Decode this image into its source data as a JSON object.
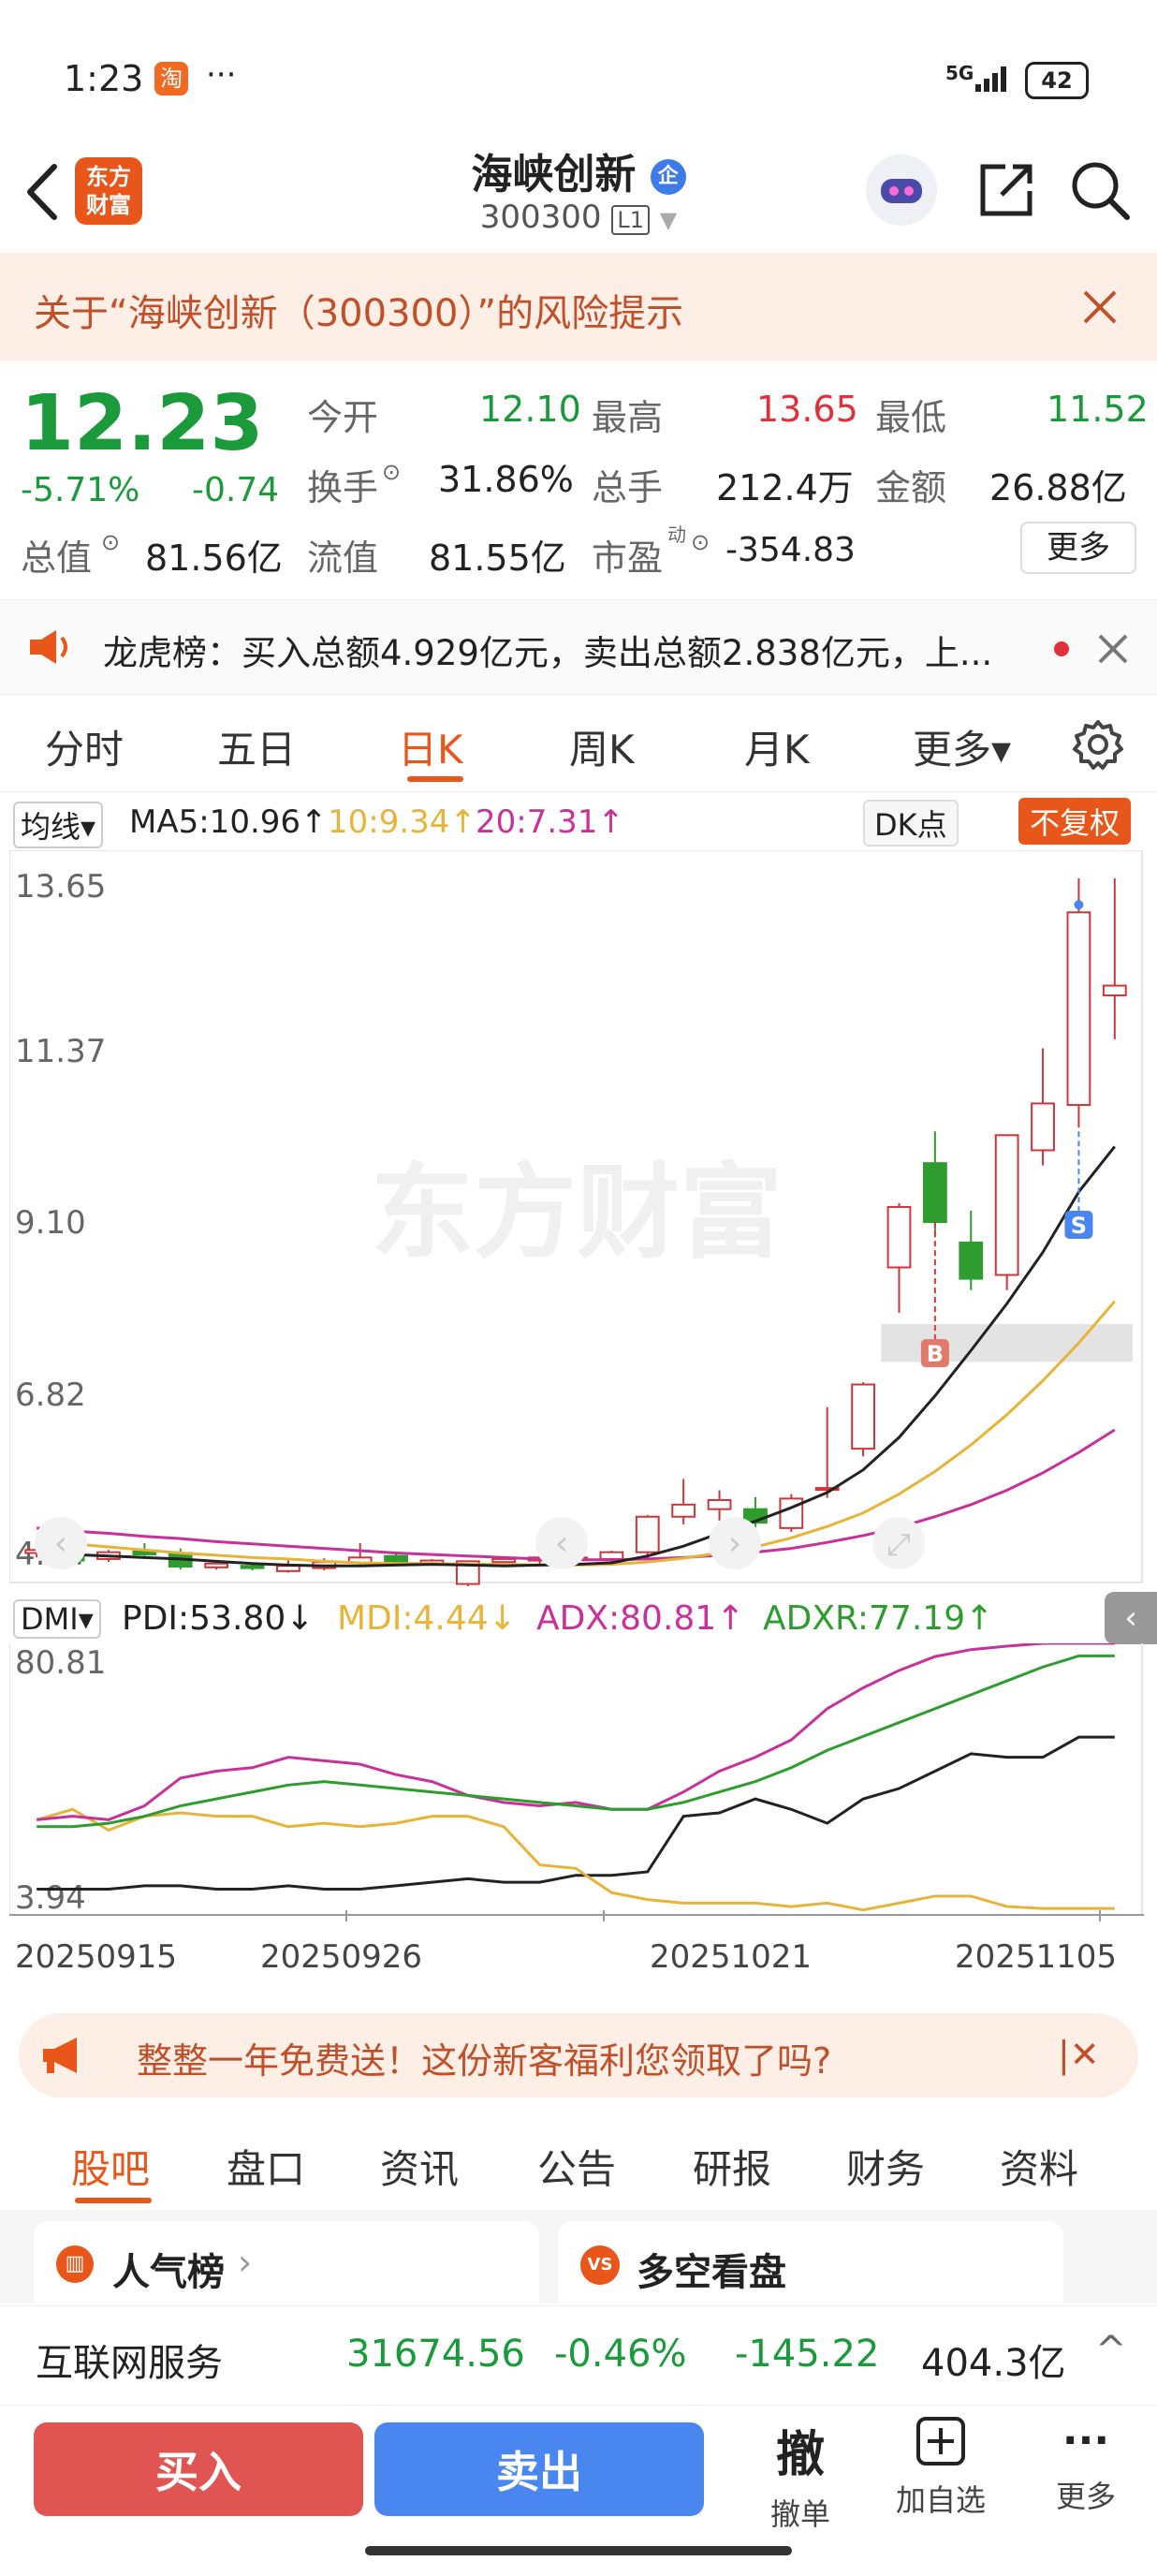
{
  "status_bar": {
    "time": "1:23",
    "app_badge": "淘",
    "dots": "···",
    "network": "5G",
    "battery": "42"
  },
  "header": {
    "logo_line1": "东方",
    "logo_line2": "财富",
    "title": "海峡创新",
    "badge": "企",
    "code": "300300",
    "level": "L1"
  },
  "risk_banner": {
    "text": "关于“海峡创新（300300）”的风险提示"
  },
  "quote": {
    "price": "12.23",
    "change_pct": "-5.71%",
    "change": "-0.74",
    "open_label": "今开",
    "open": "12.10",
    "high_label": "最高",
    "high": "13.65",
    "low_label": "最低",
    "low": "11.52",
    "turnover_label": "换手",
    "turnover": "31.86%",
    "volume_label": "总手",
    "volume": "212.4万",
    "amount_label": "金额",
    "amount": "26.88亿",
    "mcap_label": "总值",
    "mcap": "81.56亿",
    "float_label": "流值",
    "float": "81.55亿",
    "pe_label": "市盈",
    "pe_sup": "动",
    "pe": "-354.83",
    "more_label": "更多"
  },
  "dragon": {
    "text": "龙虎榜：买入总额4.929亿元，卖出总额2.838亿元，上..."
  },
  "ktabs": {
    "items": [
      "分时",
      "五日",
      "日K",
      "周K",
      "月K",
      "更多▾"
    ],
    "active": 2
  },
  "ma_legend": {
    "selector": "均线",
    "ma5": "MA5:10.96↑",
    "ma10": "10:9.34↑",
    "ma20": "20:7.31↑",
    "dk": "DK点",
    "fq": "不复权"
  },
  "colors": {
    "up": "#d0353a",
    "down": "#2e9c2e",
    "ma5": "#222222",
    "ma10": "#e8b437",
    "ma20": "#c8309a",
    "accent": "#e8561a"
  },
  "chart_data": [
    {
      "type": "candlestick",
      "y_ticks": [
        "13.65",
        "11.37",
        "9.10",
        "6.82",
        "4.54"
      ],
      "ylim": [
        4.54,
        13.65
      ],
      "markers": [
        "B",
        "S"
      ],
      "watermark": "东方财富",
      "candles": [
        {
          "o": 4.72,
          "c": 4.76,
          "h": 4.8,
          "l": 4.66
        },
        {
          "o": 4.74,
          "c": 4.62,
          "h": 4.78,
          "l": 4.55
        },
        {
          "o": 4.64,
          "c": 4.73,
          "h": 4.76,
          "l": 4.6
        },
        {
          "o": 4.74,
          "c": 4.7,
          "h": 4.85,
          "l": 4.68
        },
        {
          "o": 4.72,
          "c": 4.54,
          "h": 4.78,
          "l": 4.5
        },
        {
          "o": 4.53,
          "c": 4.58,
          "h": 4.62,
          "l": 4.5
        },
        {
          "o": 4.55,
          "c": 4.52,
          "h": 4.58,
          "l": 4.49
        },
        {
          "o": 4.48,
          "c": 4.55,
          "h": 4.64,
          "l": 4.46
        },
        {
          "o": 4.52,
          "c": 4.6,
          "h": 4.65,
          "l": 4.49
        },
        {
          "o": 4.59,
          "c": 4.66,
          "h": 4.85,
          "l": 4.55
        },
        {
          "o": 4.68,
          "c": 4.58,
          "h": 4.72,
          "l": 4.55
        },
        {
          "o": 4.58,
          "c": 4.62,
          "h": 4.64,
          "l": 4.56
        },
        {
          "o": 4.31,
          "c": 4.61,
          "h": 4.62,
          "l": 4.28
        },
        {
          "o": 4.6,
          "c": 4.64,
          "h": 4.66,
          "l": 4.55
        },
        {
          "o": 4.62,
          "c": 4.66,
          "h": 4.7,
          "l": 4.58
        },
        {
          "o": 4.63,
          "c": 4.66,
          "h": 4.7,
          "l": 4.6
        },
        {
          "o": 4.64,
          "c": 4.73,
          "h": 4.75,
          "l": 4.6
        },
        {
          "o": 4.73,
          "c": 5.2,
          "h": 5.22,
          "l": 4.65
        },
        {
          "o": 5.2,
          "c": 5.36,
          "h": 5.7,
          "l": 5.1
        },
        {
          "o": 5.3,
          "c": 5.42,
          "h": 5.55,
          "l": 5.15
        },
        {
          "o": 5.3,
          "c": 5.12,
          "h": 5.46,
          "l": 5.05
        },
        {
          "o": 5.05,
          "c": 5.44,
          "h": 5.5,
          "l": 5.0
        },
        {
          "o": 5.58,
          "c": 5.58,
          "h": 6.65,
          "l": 5.45
        },
        {
          "o": 6.1,
          "c": 6.95,
          "h": 6.98,
          "l": 6.0
        },
        {
          "o": 8.5,
          "c": 9.3,
          "h": 9.35,
          "l": 7.9
        },
        {
          "o": 9.88,
          "c": 9.1,
          "h": 10.3,
          "l": 8.9
        },
        {
          "o": 8.83,
          "c": 8.35,
          "h": 9.25,
          "l": 8.2
        },
        {
          "o": 8.4,
          "c": 10.25,
          "h": 10.25,
          "l": 8.2
        },
        {
          "o": 10.05,
          "c": 10.67,
          "h": 11.4,
          "l": 9.85
        },
        {
          "o": 10.65,
          "c": 13.2,
          "h": 13.65,
          "l": 10.35
        },
        {
          "o": 12.1,
          "c": 12.23,
          "h": 13.65,
          "l": 11.52
        }
      ],
      "ma5": [
        4.71,
        4.7,
        4.68,
        4.66,
        4.64,
        4.61,
        4.58,
        4.56,
        4.55,
        4.55,
        4.56,
        4.57,
        4.56,
        4.55,
        4.56,
        4.57,
        4.59,
        4.68,
        4.81,
        4.98,
        5.14,
        5.32,
        5.52,
        5.82,
        6.25,
        6.8,
        7.4,
        8.02,
        8.7,
        9.5,
        10.1
      ],
      "ma10": [
        4.88,
        4.84,
        4.8,
        4.76,
        4.72,
        4.69,
        4.66,
        4.64,
        4.61,
        4.59,
        4.58,
        4.58,
        4.57,
        4.57,
        4.56,
        4.56,
        4.57,
        4.6,
        4.65,
        4.72,
        4.8,
        4.92,
        5.07,
        5.25,
        5.5,
        5.8,
        6.15,
        6.55,
        7.0,
        7.5,
        8.05
      ],
      "ma20": [
        5.05,
        5.01,
        4.98,
        4.94,
        4.91,
        4.87,
        4.84,
        4.81,
        4.78,
        4.75,
        4.72,
        4.7,
        4.68,
        4.66,
        4.64,
        4.63,
        4.63,
        4.64,
        4.66,
        4.69,
        4.73,
        4.78,
        4.86,
        4.95,
        5.06,
        5.2,
        5.36,
        5.55,
        5.78,
        6.05,
        6.35
      ]
    },
    {
      "type": "line",
      "y_ticks": [
        "80.81",
        "3.94"
      ],
      "ylim": [
        3.94,
        80.81
      ],
      "series": [
        {
          "name": "PDI",
          "values": [
            10,
            10,
            10,
            11,
            11,
            10,
            10,
            11,
            10,
            10,
            11,
            12,
            13,
            12,
            12,
            14,
            14,
            15,
            31,
            32,
            36,
            33,
            29,
            36,
            39,
            44,
            49,
            48,
            48,
            53.8,
            53.8
          ]
        },
        {
          "name": "MDI",
          "values": [
            30,
            33,
            27,
            31,
            32,
            31,
            31,
            28,
            29,
            28,
            29,
            31,
            31,
            28,
            17,
            16,
            9,
            7,
            6,
            6,
            6,
            5,
            6,
            4,
            6,
            8,
            8,
            5,
            4.44,
            4.44,
            4.44
          ]
        },
        {
          "name": "ADX",
          "values": [
            30,
            31,
            30,
            34,
            42,
            44,
            45,
            48,
            47,
            46,
            43,
            41,
            37,
            35,
            34,
            35,
            33,
            33,
            38,
            44,
            48,
            53,
            62,
            68,
            73,
            77,
            79,
            80,
            80.81,
            80.81,
            80.81
          ]
        },
        {
          "name": "ADXR",
          "values": [
            28,
            28,
            29,
            31,
            34,
            36,
            38,
            40,
            41,
            40,
            39,
            38,
            37,
            36,
            35,
            34,
            33,
            33,
            35,
            38,
            41,
            45,
            50,
            54,
            58,
            62,
            66,
            70,
            74,
            77.19,
            77.19
          ]
        }
      ]
    }
  ],
  "dmi_legend": {
    "selector": "DMI",
    "pdi": "PDI:53.80↓",
    "mdi": "MDI:4.44↓",
    "adx": "ADX:80.81↑",
    "adxr": "ADXR:77.19↑"
  },
  "dates": [
    "20250915",
    "20250926",
    "20251021",
    "20251105"
  ],
  "promo": {
    "text": "整整一年免费送！这份新客福利您领取了吗?"
  },
  "btabs": {
    "items": [
      "股吧",
      "盘口",
      "资讯",
      "公告",
      "研报",
      "财务",
      "资料"
    ],
    "active": 0
  },
  "cards": {
    "left": "人气榜",
    "right": "多空看盘",
    "right_badge": "VS"
  },
  "industry": {
    "name": "互联网服务",
    "index": "31674.56",
    "pct": "-0.46%",
    "change": "-145.22",
    "amount": "404.3亿"
  },
  "actions": {
    "buy": "买入",
    "sell": "卖出",
    "cancel_glyph": "撤",
    "cancel_label": "撤单",
    "add_label": "加自选",
    "more_label": "更多"
  }
}
